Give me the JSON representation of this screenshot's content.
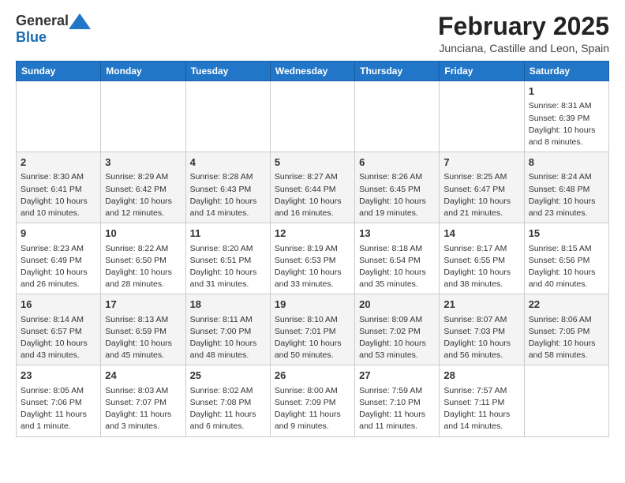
{
  "header": {
    "logo_general": "General",
    "logo_blue": "Blue",
    "main_title": "February 2025",
    "subtitle": "Junciana, Castille and Leon, Spain"
  },
  "columns": [
    "Sunday",
    "Monday",
    "Tuesday",
    "Wednesday",
    "Thursday",
    "Friday",
    "Saturday"
  ],
  "weeks": [
    {
      "days": [
        {
          "num": "",
          "info": ""
        },
        {
          "num": "",
          "info": ""
        },
        {
          "num": "",
          "info": ""
        },
        {
          "num": "",
          "info": ""
        },
        {
          "num": "",
          "info": ""
        },
        {
          "num": "",
          "info": ""
        },
        {
          "num": "1",
          "info": "Sunrise: 8:31 AM\nSunset: 6:39 PM\nDaylight: 10 hours and 8 minutes."
        }
      ]
    },
    {
      "days": [
        {
          "num": "2",
          "info": "Sunrise: 8:30 AM\nSunset: 6:41 PM\nDaylight: 10 hours and 10 minutes."
        },
        {
          "num": "3",
          "info": "Sunrise: 8:29 AM\nSunset: 6:42 PM\nDaylight: 10 hours and 12 minutes."
        },
        {
          "num": "4",
          "info": "Sunrise: 8:28 AM\nSunset: 6:43 PM\nDaylight: 10 hours and 14 minutes."
        },
        {
          "num": "5",
          "info": "Sunrise: 8:27 AM\nSunset: 6:44 PM\nDaylight: 10 hours and 16 minutes."
        },
        {
          "num": "6",
          "info": "Sunrise: 8:26 AM\nSunset: 6:45 PM\nDaylight: 10 hours and 19 minutes."
        },
        {
          "num": "7",
          "info": "Sunrise: 8:25 AM\nSunset: 6:47 PM\nDaylight: 10 hours and 21 minutes."
        },
        {
          "num": "8",
          "info": "Sunrise: 8:24 AM\nSunset: 6:48 PM\nDaylight: 10 hours and 23 minutes."
        }
      ]
    },
    {
      "days": [
        {
          "num": "9",
          "info": "Sunrise: 8:23 AM\nSunset: 6:49 PM\nDaylight: 10 hours and 26 minutes."
        },
        {
          "num": "10",
          "info": "Sunrise: 8:22 AM\nSunset: 6:50 PM\nDaylight: 10 hours and 28 minutes."
        },
        {
          "num": "11",
          "info": "Sunrise: 8:20 AM\nSunset: 6:51 PM\nDaylight: 10 hours and 31 minutes."
        },
        {
          "num": "12",
          "info": "Sunrise: 8:19 AM\nSunset: 6:53 PM\nDaylight: 10 hours and 33 minutes."
        },
        {
          "num": "13",
          "info": "Sunrise: 8:18 AM\nSunset: 6:54 PM\nDaylight: 10 hours and 35 minutes."
        },
        {
          "num": "14",
          "info": "Sunrise: 8:17 AM\nSunset: 6:55 PM\nDaylight: 10 hours and 38 minutes."
        },
        {
          "num": "15",
          "info": "Sunrise: 8:15 AM\nSunset: 6:56 PM\nDaylight: 10 hours and 40 minutes."
        }
      ]
    },
    {
      "days": [
        {
          "num": "16",
          "info": "Sunrise: 8:14 AM\nSunset: 6:57 PM\nDaylight: 10 hours and 43 minutes."
        },
        {
          "num": "17",
          "info": "Sunrise: 8:13 AM\nSunset: 6:59 PM\nDaylight: 10 hours and 45 minutes."
        },
        {
          "num": "18",
          "info": "Sunrise: 8:11 AM\nSunset: 7:00 PM\nDaylight: 10 hours and 48 minutes."
        },
        {
          "num": "19",
          "info": "Sunrise: 8:10 AM\nSunset: 7:01 PM\nDaylight: 10 hours and 50 minutes."
        },
        {
          "num": "20",
          "info": "Sunrise: 8:09 AM\nSunset: 7:02 PM\nDaylight: 10 hours and 53 minutes."
        },
        {
          "num": "21",
          "info": "Sunrise: 8:07 AM\nSunset: 7:03 PM\nDaylight: 10 hours and 56 minutes."
        },
        {
          "num": "22",
          "info": "Sunrise: 8:06 AM\nSunset: 7:05 PM\nDaylight: 10 hours and 58 minutes."
        }
      ]
    },
    {
      "days": [
        {
          "num": "23",
          "info": "Sunrise: 8:05 AM\nSunset: 7:06 PM\nDaylight: 11 hours and 1 minute."
        },
        {
          "num": "24",
          "info": "Sunrise: 8:03 AM\nSunset: 7:07 PM\nDaylight: 11 hours and 3 minutes."
        },
        {
          "num": "25",
          "info": "Sunrise: 8:02 AM\nSunset: 7:08 PM\nDaylight: 11 hours and 6 minutes."
        },
        {
          "num": "26",
          "info": "Sunrise: 8:00 AM\nSunset: 7:09 PM\nDaylight: 11 hours and 9 minutes."
        },
        {
          "num": "27",
          "info": "Sunrise: 7:59 AM\nSunset: 7:10 PM\nDaylight: 11 hours and 11 minutes."
        },
        {
          "num": "28",
          "info": "Sunrise: 7:57 AM\nSunset: 7:11 PM\nDaylight: 11 hours and 14 minutes."
        },
        {
          "num": "",
          "info": ""
        }
      ]
    }
  ]
}
